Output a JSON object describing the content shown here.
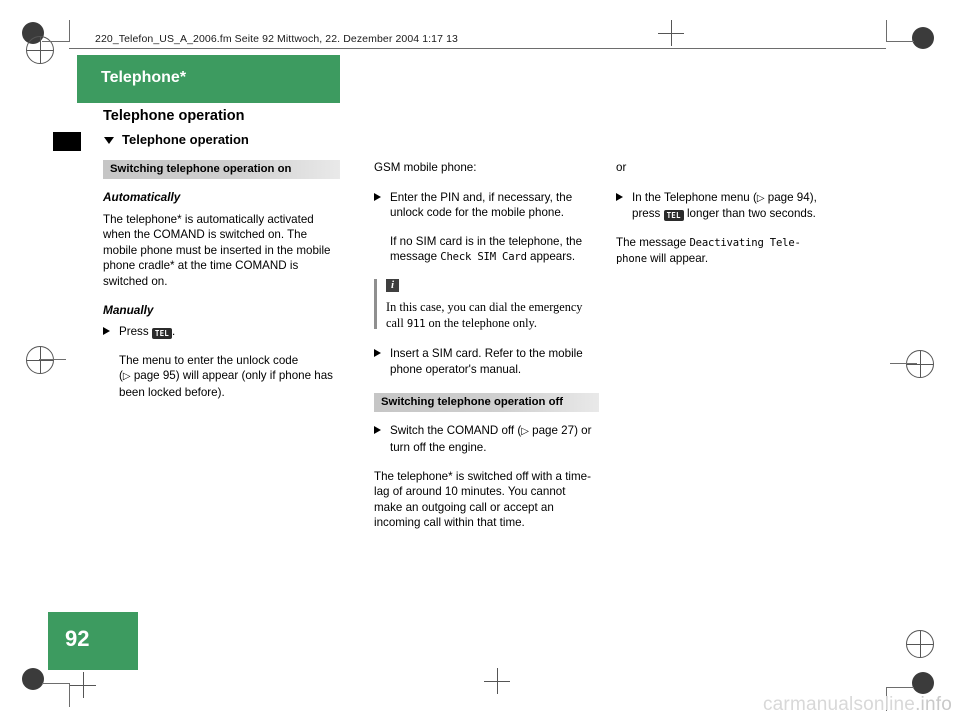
{
  "header": {
    "file_line": "220_Telefon_US_A_2006.fm  Seite 92  Mittwoch, 22. Dezember 2004  1:17 13"
  },
  "chapter": {
    "tab_title": "Telephone*",
    "heading": "Telephone operation",
    "subheading": "Telephone operation"
  },
  "page": {
    "number": "92"
  },
  "col1": {
    "section_bar": "Switching telephone operation on",
    "auto_head": "Automatically",
    "auto_text": "The telephone* is automatically activated when the COMAND is switched on. The mobile phone must be inserted in the mobile phone cradle* at the time COMAND is switched on.",
    "manual_head": "Manually",
    "press_label": "Press",
    "press_key": "TEL",
    "press_period": ".",
    "menu_text_a": "The menu to enter the unlock code (",
    "menu_pgref": "page 95",
    "menu_text_b": ") will appear (only if phone has been locked before)."
  },
  "col2": {
    "gsm_label": "GSM mobile phone:",
    "bullet_pin": "Enter the PIN and, if necessary, the unlock code for the mobile phone.",
    "no_sim_a": "If no SIM card is in the telephone, the message",
    "no_sim_msg": "Check SIM Card",
    "no_sim_b": "appears.",
    "note_icon": "i",
    "note_text_a": "In this case, you can dial the emergency call",
    "note_number": "911",
    "note_text_b": "on the telephone only.",
    "bullet_insert": "Insert a SIM card. Refer to the mobile phone operator's manual.",
    "section_bar_off": "Switching telephone operation off",
    "bullet_switch_a": "Switch the COMAND off (",
    "bullet_switch_pgref": "page 27",
    "bullet_switch_b": ") or turn off the engine.",
    "switched_off_text": "The telephone* is switched off with a time-lag of around 10 minutes. You cannot make an outgoing call or accept an incoming call within that time."
  },
  "col3": {
    "or_label": "or",
    "bullet_menu_a": "In the Telephone menu (",
    "bullet_menu_pgref": "page 94",
    "bullet_menu_b": "), press",
    "bullet_menu_key": "TEL",
    "bullet_menu_c": "longer than two seconds.",
    "message_a": "The message",
    "message_mono_1": "Deactivating Tele-",
    "message_mono_2": "phone",
    "message_b": "will appear."
  },
  "watermark": {
    "text_main": "carmanualsonline",
    "text_suffix": ".info"
  },
  "colors": {
    "green": "#3d9b60",
    "grey_bar": "#c6c6c6",
    "key_black": "#2b2b2b"
  }
}
